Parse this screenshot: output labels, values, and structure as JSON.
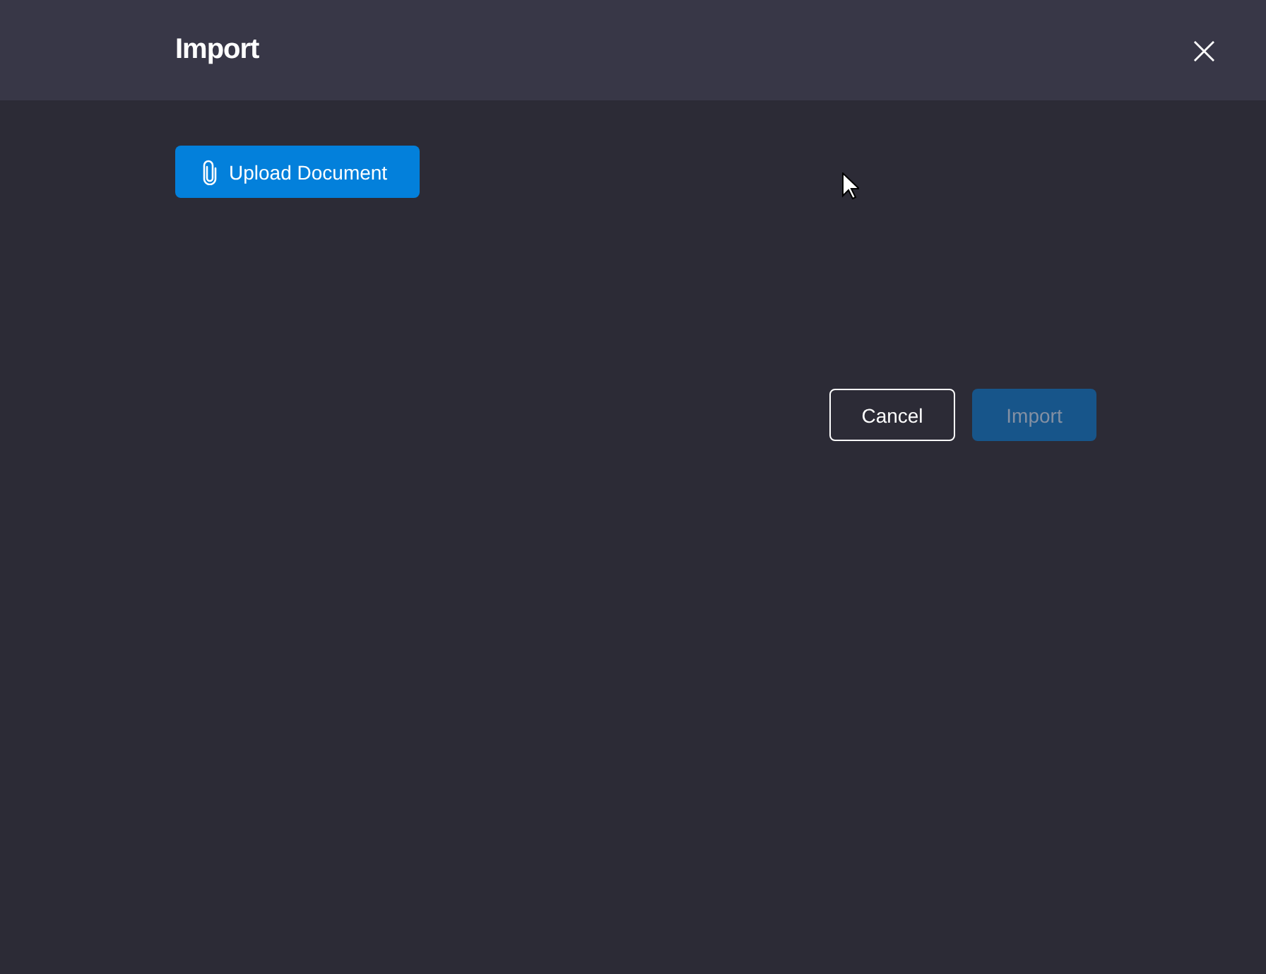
{
  "dialog": {
    "title": "Import",
    "close": "×"
  },
  "upload_button": {
    "label": "Upload Document"
  },
  "buttons": [
    {
      "label": "Cancel",
      "kind": "outline",
      "disabled": false
    },
    {
      "label": "Import",
      "kind": "primary",
      "disabled": true
    }
  ]
}
